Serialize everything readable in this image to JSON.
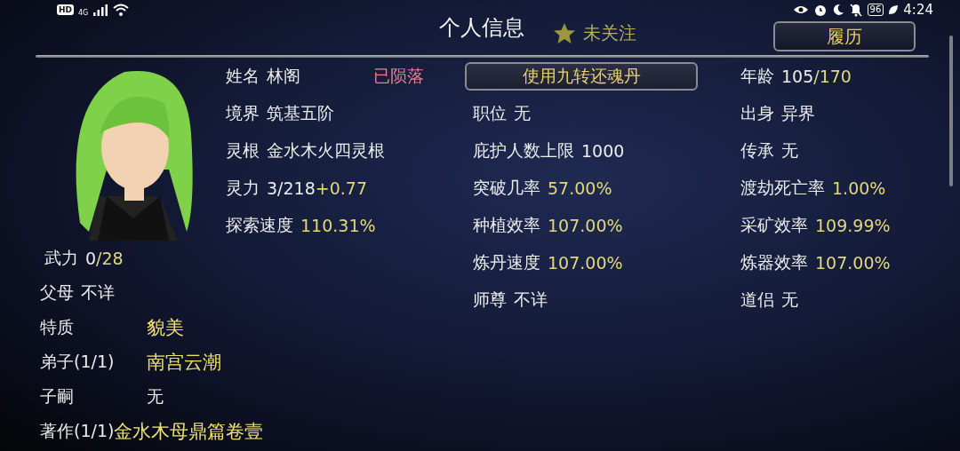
{
  "status_bar": {
    "hd": "HD",
    "network": "4G",
    "battery": "96",
    "time": "4:24"
  },
  "header": {
    "title": "个人信息",
    "follow": {
      "label": "未关注",
      "followed": false
    },
    "resume_button": "履历"
  },
  "life_status": "已陨落",
  "revive_button": "使用九转还魂丹",
  "column_1": [
    {
      "label": "姓名",
      "value": "林阁"
    },
    {
      "label": "境界",
      "value": "筑基五阶"
    },
    {
      "label": "灵根",
      "value": "金水木火四灵根"
    },
    {
      "label": "灵力",
      "value": "3/218",
      "accent": "+0.77"
    },
    {
      "label": "探索速度",
      "accent": "110.31%"
    }
  ],
  "column_2": [
    {
      "label": "职位",
      "value": "无"
    },
    {
      "label": "庇护人数上限",
      "value": "1000"
    },
    {
      "label": "突破几率",
      "accent": "57.00%"
    },
    {
      "label": "种植效率",
      "accent": "107.00%"
    },
    {
      "label": "炼丹速度",
      "accent": "107.00%"
    },
    {
      "label": "师尊",
      "value": "不详"
    }
  ],
  "column_3": [
    {
      "label": "年龄",
      "value": "105",
      "accent": "/170"
    },
    {
      "label": "出身",
      "value": "异界"
    },
    {
      "label": "传承",
      "value": "无"
    },
    {
      "label": "渡劫死亡率",
      "accent": "1.00%"
    },
    {
      "label": "采矿效率",
      "accent": "109.99%"
    },
    {
      "label": "炼器效率",
      "accent": "107.00%"
    },
    {
      "label": "道侣",
      "value": "无"
    }
  ],
  "relations": [
    {
      "kind": "inline",
      "label": "武力",
      "value": "0",
      "accent": "/28"
    },
    {
      "kind": "inline",
      "label": "父母",
      "value": "不详"
    },
    {
      "kind": "tabbed",
      "label": "特质",
      "accent": "貌美"
    },
    {
      "kind": "tabbed",
      "label": "弟子(1/1)",
      "accent": "南宫云潮"
    },
    {
      "kind": "tabbed",
      "label": "子嗣",
      "value": "无"
    },
    {
      "kind": "tabbed",
      "label": "著作(1/1)",
      "accent": "金水木母鼎篇卷壹"
    }
  ]
}
